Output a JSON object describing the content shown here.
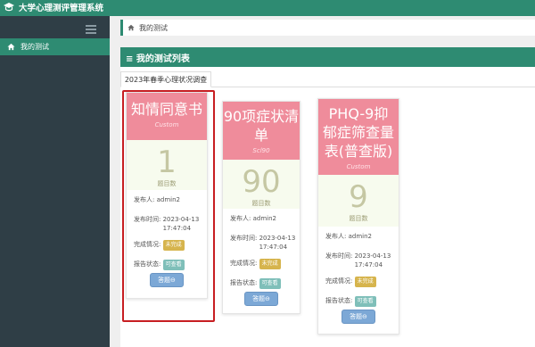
{
  "app": {
    "title": "大学心理测评管理系统"
  },
  "sidebar": {
    "items": [
      {
        "label": "我的测试",
        "icon": "home-icon"
      }
    ]
  },
  "breadcrumb": {
    "label": "我的测试",
    "icon": "home-icon"
  },
  "panel": {
    "title": "≡ 我的测试列表"
  },
  "tabs": [
    {
      "label": "2023年春季心理状况调查"
    }
  ],
  "cards": [
    {
      "title": "知情同意书",
      "subtitle": "Custom",
      "count": "1",
      "count_label": "题目数",
      "publisher_label": "发布人:",
      "publisher": "admin2",
      "time_label": "发布时间:",
      "time": "2023-04-13 17:47:04",
      "status_label": "完成情况:",
      "status": "未完成",
      "report_label": "报告状态:",
      "report": "可查看",
      "button": "答题⊖"
    },
    {
      "title": "90项症状清单",
      "subtitle": "Scl90",
      "count": "90",
      "count_label": "题目数",
      "publisher_label": "发布人:",
      "publisher": "admin2",
      "time_label": "发布时间:",
      "time": "2023-04-13 17:47:04",
      "status_label": "完成情况:",
      "status": "未完成",
      "report_label": "报告状态:",
      "report": "可查看",
      "button": "答题⊖"
    },
    {
      "title": "PHQ-9抑郁症筛查量表(普查版)",
      "subtitle": "Custom",
      "count": "9",
      "count_label": "题目数",
      "publisher_label": "发布人:",
      "publisher": "admin2",
      "time_label": "发布时间:",
      "time": "2023-04-13 17:47:04",
      "status_label": "完成情况:",
      "status": "未完成",
      "report_label": "报告状态:",
      "report": "可查看",
      "button": "答题⊖"
    }
  ],
  "colors": {
    "brand": "#2e8b72",
    "sidebar": "#2f3e46",
    "card_head": "#ef8c9b",
    "button": "#7ca8d6",
    "highlight": "#c71e22"
  }
}
